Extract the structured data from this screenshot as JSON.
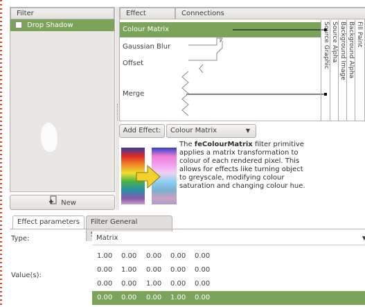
{
  "filter_panel": {
    "header": "Filter",
    "items": [
      {
        "name": "Drop Shadow",
        "checked": false,
        "selected": true
      }
    ],
    "new_button": "New"
  },
  "effect_panel": {
    "col_effect": "Effect",
    "col_connections": "Connections",
    "effects": [
      "Colour Matrix",
      "Gaussian Blur",
      "Offset",
      "Merge"
    ],
    "inputs": [
      "Source Graphic",
      "Source Alpha",
      "Background Image",
      "Background Alpha",
      "Fill Paint"
    ],
    "add_effect_label": "Add Effect:",
    "add_effect_value": "Colour Matrix",
    "description": {
      "prefix": "The ",
      "name": "feColourMatrix",
      "text": " filter primitive applies a matrix transformation to colour of each rendered pixel. This allows for effects like turning object to greyscale, modifying colour saturation and changing colour hue."
    }
  },
  "tabs": [
    "Effect parameters",
    "Filter General Settings"
  ],
  "params": {
    "type_label": "Type:",
    "type_value": "Matrix",
    "values_label": "Value(s):",
    "matrix": [
      [
        "1.00",
        "0.00",
        "0.00",
        "0.00",
        "0.00"
      ],
      [
        "0.00",
        "1.00",
        "0.00",
        "0.00",
        "0.00"
      ],
      [
        "0.00",
        "0.00",
        "1.00",
        "0.00",
        "0.00"
      ],
      [
        "0.00",
        "0.00",
        "0.00",
        "1.00",
        "0.00"
      ]
    ],
    "selected_row": 3
  },
  "colors": {
    "selection": "#7ca35a",
    "panel": "#e9e6e3"
  }
}
